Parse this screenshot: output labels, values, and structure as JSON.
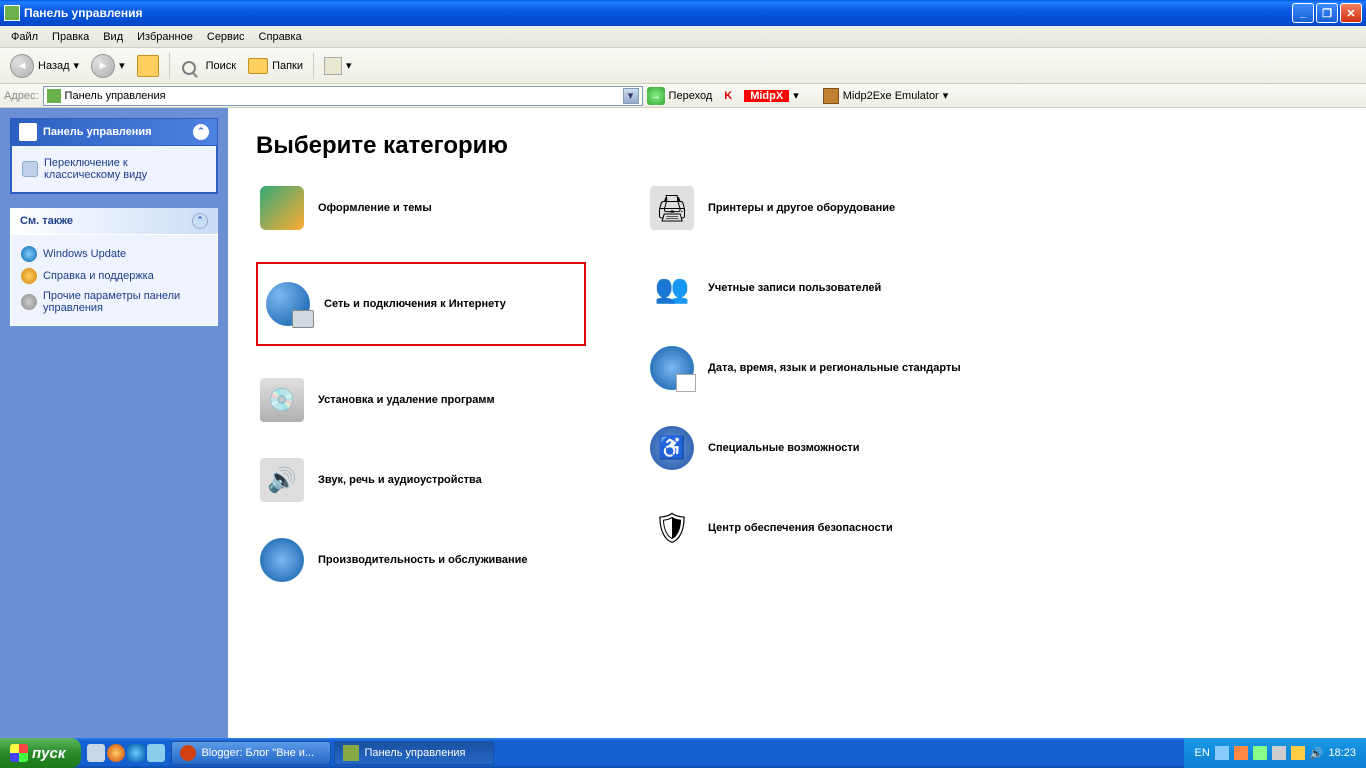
{
  "window": {
    "title": "Панель управления"
  },
  "menu": {
    "file": "Файл",
    "edit": "Правка",
    "view": "Вид",
    "favorites": "Избранное",
    "service": "Сервис",
    "help": "Справка"
  },
  "toolbar": {
    "back": "Назад",
    "search": "Поиск",
    "folders": "Папки"
  },
  "address": {
    "label": "Адрес:",
    "value": "Панель управления",
    "go": "Переход",
    "midpx": "MidpX",
    "emulator": "Midp2Exe Emulator"
  },
  "sidebar": {
    "panel1_title": "Панель управления",
    "switch_view": "Переключение к классическому виду",
    "see_also": "См. также",
    "links": {
      "winupdate": "Windows Update",
      "help": "Справка и поддержка",
      "other": "Прочие параметры панели управления"
    }
  },
  "content": {
    "heading": "Выберите категорию",
    "left": {
      "themes": "Оформление и темы",
      "network": "Сеть и подключения к Интернету",
      "programs": "Установка и удаление программ",
      "sound": "Звук, речь и аудиоустройства",
      "perf": "Производительность и обслуживание"
    },
    "right": {
      "printers": "Принтеры и другое оборудование",
      "users": "Учетные записи пользователей",
      "date": "Дата, время, язык и региональные стандарты",
      "access": "Специальные возможности",
      "security": "Центр обеспечения безопасности"
    }
  },
  "taskbar": {
    "start": "пуск",
    "tasks": {
      "blogger": "Blogger: Блог \"Вне и...",
      "cp": "Панель управления"
    },
    "lang": "EN",
    "time": "18:23"
  }
}
